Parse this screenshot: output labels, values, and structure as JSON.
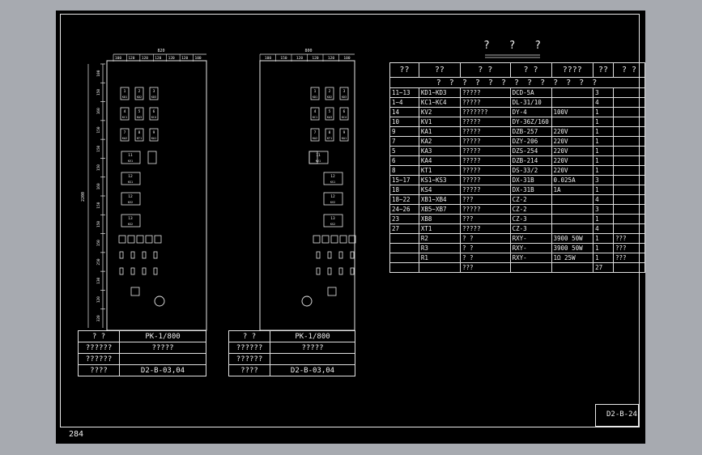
{
  "page_number": "284",
  "drawing_number": "D2-B-24",
  "table_title": "? ? ?",
  "parts_table": {
    "headers": [
      "??",
      "??",
      "? ?",
      "? ?",
      "????",
      "??",
      "? ?"
    ],
    "subheader": "? ? ? ? ? ? ? ? ? ? ? ? ?",
    "rows": [
      [
        "11~13",
        "KD1~KD3",
        "?????",
        "DCD-5A",
        "",
        "3",
        ""
      ],
      [
        "1~4",
        "KC1~KC4",
        "?????",
        "DL-31/10",
        "",
        "4",
        ""
      ],
      [
        "14",
        "KV2",
        "???????",
        "DY-4",
        "100V",
        "1",
        ""
      ],
      [
        "10",
        "KV1",
        "?????",
        "DY-36Z/160",
        "",
        "1",
        ""
      ],
      [
        "9",
        "KA1",
        "?????",
        "DZB-257",
        "220V",
        "1",
        ""
      ],
      [
        "7",
        "KA2",
        "?????",
        "DZY-206",
        "220V",
        "1",
        ""
      ],
      [
        "5",
        "KA3",
        "?????",
        "DZS-254",
        "220V",
        "1",
        ""
      ],
      [
        "6",
        "KA4",
        "?????",
        "DZB-214",
        "220V",
        "1",
        ""
      ],
      [
        "8",
        "KT1",
        "?????",
        "DS-33/2",
        "220V",
        "1",
        ""
      ],
      [
        "15~17",
        "KS1~KS3",
        "?????",
        "DX-31B",
        "0.025A",
        "3",
        ""
      ],
      [
        "18",
        "KS4",
        "?????",
        "DX-31B",
        "1A",
        "1",
        ""
      ],
      [
        "18~22",
        "XB1~XB4",
        "???",
        "CZ-2",
        "",
        "4",
        ""
      ],
      [
        "24~26",
        "XB5~XB7",
        "?????",
        "CZ-2",
        "",
        "3",
        ""
      ],
      [
        "23",
        "XB8",
        "???",
        "CZ-3",
        "",
        "1",
        ""
      ],
      [
        "27",
        "XT1",
        "?????",
        "CZ-3",
        "",
        "4",
        ""
      ],
      [
        "",
        "R2",
        "? ?",
        "RXY-",
        "3900   50W",
        "1",
        "???"
      ],
      [
        "",
        "R3",
        "? ?",
        "RXY-",
        "3900   50W",
        "1",
        "???"
      ],
      [
        "",
        "R1",
        "? ?",
        "RXY-",
        "1Ω    25W",
        "1",
        "???"
      ],
      [
        "",
        "",
        "???",
        "",
        "",
        "27",
        ""
      ]
    ]
  },
  "left_panel": {
    "overall_width": "820",
    "overall_height": "2200",
    "dims": [
      "100",
      "120",
      "120",
      "120",
      "120",
      "120",
      "100"
    ],
    "right_dims": [
      "100",
      "150",
      "160",
      "150",
      "150",
      "150",
      "160",
      "150",
      "150",
      "150",
      "250",
      "130",
      "120",
      "320"
    ],
    "relays": [
      [
        "1",
        "KD1"
      ],
      [
        "2",
        "KD2"
      ],
      [
        "3",
        "KD3"
      ],
      [
        "4",
        "KC1"
      ],
      [
        "5",
        "KA3"
      ],
      [
        "6",
        "KC4"
      ],
      [
        "7",
        "KA2"
      ],
      [
        "8",
        "KT1"
      ],
      [
        "9",
        "KA1"
      ],
      [
        "11",
        "KV1"
      ],
      [
        "12",
        "KS1"
      ],
      [
        "12",
        "KV2"
      ],
      [
        "13",
        "KS2"
      ],
      [
        "14",
        "KV2"
      ]
    ],
    "title_block": [
      [
        "? ?",
        "PK-1/800"
      ],
      [
        "??????",
        "?????"
      ],
      [
        "??????",
        ""
      ],
      [
        "????",
        "D2-B-03,04"
      ]
    ]
  },
  "right_panel": {
    "overall_width": "800",
    "dims": [
      "100",
      "150",
      "120",
      "120",
      "120",
      "100"
    ],
    "title_block": [
      [
        "? ?",
        "PK-1/800"
      ],
      [
        "??????",
        "?????"
      ],
      [
        "??????",
        ""
      ],
      [
        "????",
        "D2-B-03,04"
      ]
    ]
  }
}
